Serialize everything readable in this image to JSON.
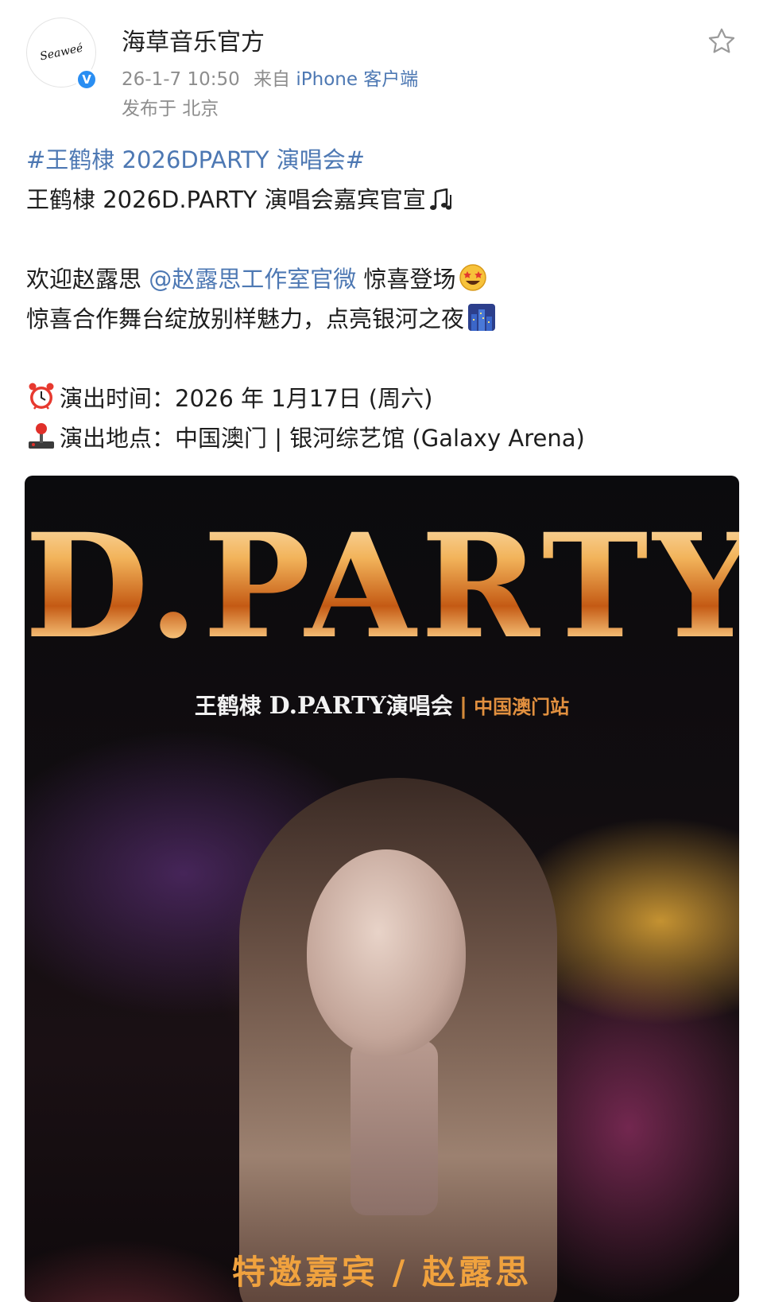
{
  "post": {
    "username": "海草音乐官方",
    "timestamp": "26-1-7 10:50",
    "source_prefix": "来自",
    "source_client": "iPhone 客户端",
    "location": "发布于 北京",
    "verified_mark": "V",
    "avatar_text": "Seaweé"
  },
  "content": {
    "topic": "#王鹤棣 2026DPARTY 演唱会#",
    "line2": "王鹤棣 2026D.PARTY 演唱会嘉宾官宣",
    "line3_prefix": "欢迎赵露思 ",
    "mention": "@赵露思工作室官微",
    "line3_suffix": " 惊喜登场",
    "line4": "惊喜合作舞台绽放别样魅力，点亮银河之夜",
    "time_line": "演出时间：2026 年 1月17日 (周六)",
    "venue_line": "演出地点：中国澳门 | 银河综艺馆 (Galaxy Arena)"
  },
  "icons": {
    "music": "music-notes-icon",
    "starstruck": "star-struck-emoji",
    "city": "night-city-emoji",
    "clock": "alarm-clock-emoji",
    "joystick": "joystick-emoji",
    "favorite": "star-outline-icon"
  },
  "poster": {
    "title": "D.PARTY",
    "sub_name": "王鹤棣",
    "sub_brand": "D.PARTY",
    "sub_concert": "演唱会",
    "sub_city": "中国澳门站",
    "guest_label": "特邀嘉宾",
    "guest_name": "赵露思"
  },
  "colors": {
    "link": "#4d78b3",
    "meta": "#8d8d8d",
    "verified": "#2a8ef2",
    "poster_gold": "#f0a23e"
  }
}
